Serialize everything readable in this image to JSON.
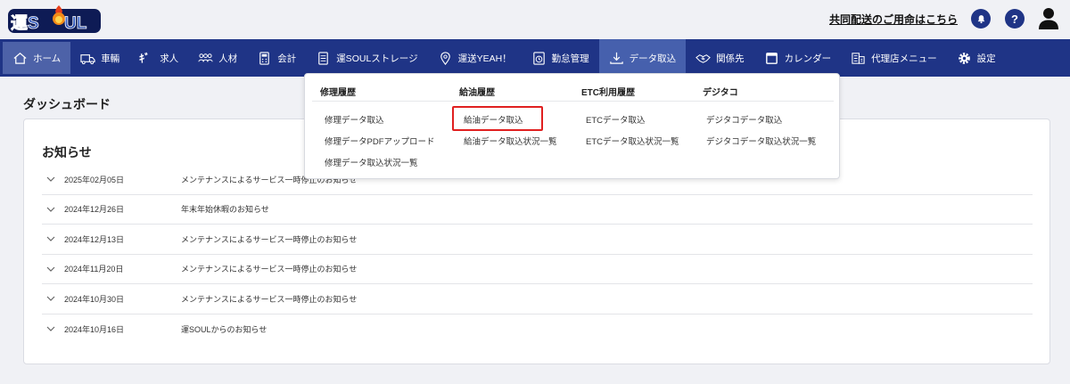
{
  "header": {
    "logo_text": "運SOUL",
    "contact_link": "共同配送のご用命はこちら",
    "help_glyph": "?"
  },
  "nav": {
    "items": [
      {
        "label": "ホーム",
        "icon": "home-icon"
      },
      {
        "label": "車輛",
        "icon": "truck-icon"
      },
      {
        "label": "求人",
        "icon": "job-icon"
      },
      {
        "label": "人材",
        "icon": "people-icon"
      },
      {
        "label": "会計",
        "icon": "calculator-icon"
      },
      {
        "label": "運SOULストレージ",
        "icon": "document-icon"
      },
      {
        "label": "運送YEAH！",
        "icon": "location-pin-icon"
      },
      {
        "label": "勤怠管理",
        "icon": "timecard-icon"
      },
      {
        "label": "データ取込",
        "icon": "download-icon"
      },
      {
        "label": "関係先",
        "icon": "handshake-icon"
      },
      {
        "label": "カレンダー",
        "icon": "calendar-icon"
      },
      {
        "label": "代理店メニュー",
        "icon": "agency-icon"
      },
      {
        "label": "設定",
        "icon": "gear-icon"
      }
    ],
    "active_color": "#4d62a8",
    "bar_color": "#1f3486"
  },
  "dropdown": {
    "columns": [
      {
        "heading": "修理履歴",
        "items": [
          "修理データ取込",
          "修理データPDFアップロード",
          "修理データ取込状況一覧"
        ]
      },
      {
        "heading": "給油履歴",
        "items": [
          "給油データ取込",
          "給油データ取込状況一覧"
        ]
      },
      {
        "heading": "ETC利用履歴",
        "items": [
          "ETCデータ取込",
          "ETCデータ取込状況一覧"
        ]
      },
      {
        "heading": "デジタコ",
        "items": [
          "デジタコデータ取込",
          "デジタコデータ取込状況一覧"
        ]
      }
    ],
    "highlight_color": "#e02020"
  },
  "main": {
    "page_title": "ダッシュボード",
    "news_title": "お知らせ",
    "news": [
      {
        "date": "2025年02月05日",
        "title": "メンテナンスによるサービス一時停止のお知らせ"
      },
      {
        "date": "2024年12月26日",
        "title": "年末年始休暇のお知らせ"
      },
      {
        "date": "2024年12月13日",
        "title": "メンテナンスによるサービス一時停止のお知らせ"
      },
      {
        "date": "2024年11月20日",
        "title": "メンテナンスによるサービス一時停止のお知らせ"
      },
      {
        "date": "2024年10月30日",
        "title": "メンテナンスによるサービス一時停止のお知らせ"
      },
      {
        "date": "2024年10月16日",
        "title": "運SOULからのお知らせ"
      }
    ]
  }
}
